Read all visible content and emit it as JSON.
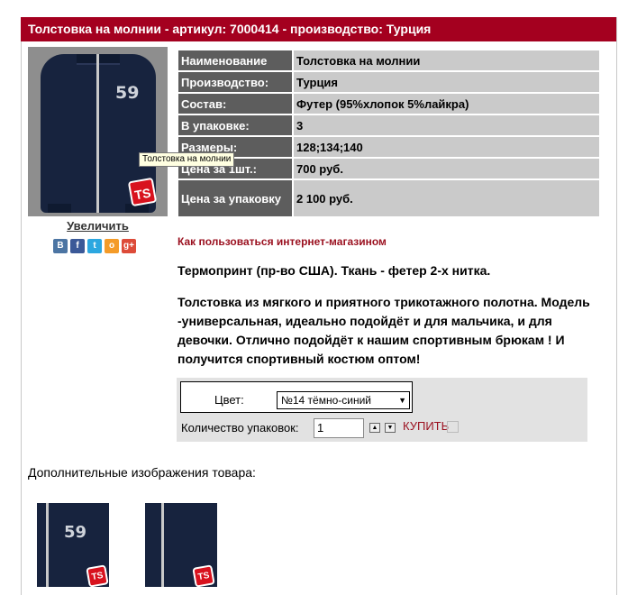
{
  "title": "Толстовка на молнии - артикул: 7000414 - производство: Турция",
  "image": {
    "number_print": "59",
    "logo_text": "TS",
    "tooltip": "Толстовка на молнии",
    "enlarge_label": "Увеличить"
  },
  "social": [
    {
      "icon": "vk-icon",
      "glyph": "В",
      "color": "#4c75a3"
    },
    {
      "icon": "facebook-icon",
      "glyph": "f",
      "color": "#3b5998"
    },
    {
      "icon": "twitter-icon",
      "glyph": "t",
      "color": "#2ca7e0"
    },
    {
      "icon": "odnoklassniki-icon",
      "glyph": "o",
      "color": "#f49b28"
    },
    {
      "icon": "googleplus-icon",
      "glyph": "g+",
      "color": "#dd4b39"
    }
  ],
  "specs": [
    {
      "key": "Наименование",
      "value": "Толстовка на молнии"
    },
    {
      "key": "Производство:",
      "value": "Турция"
    },
    {
      "key": "Состав:",
      "value": "Футер (95%хлопок 5%лайкра)"
    },
    {
      "key": "В упаковке:",
      "value": "3"
    },
    {
      "key": "Размеры:",
      "value": "128;134;140"
    },
    {
      "key": "Цена за 1шт.:",
      "value": "700 руб."
    },
    {
      "key": "Цена за упаковку",
      "value": "2 100 руб."
    }
  ],
  "how_to_link": "Как пользоваться интернет-магазином",
  "description_1": "Термопринт (пр-во США). Ткань - фетер 2-х нитка.",
  "description_2": "Толстовка из  мягкого и приятного трикотажного полотна. Модель -универсальная, идеально подойдёт и для мальчика, и для девочки. Отлично подойдёт к нашим спортивным брюкам ! И получится спортивный костюм оптом!",
  "order": {
    "color_label": "Цвет:",
    "color_value": "№14 тёмно-синий",
    "qty_label": "Количество упаковок:",
    "qty_value": "1",
    "buy_label": "КУПИТЬ"
  },
  "more_images_label": "Дополнительные изображения товара:",
  "colors": {
    "title_bg": "#a4001f",
    "key_bg": "#5d5d5d",
    "value_bg": "#cacaca",
    "link": "#9a0f1e",
    "jacket": "#17233e",
    "logo": "#d8121e"
  }
}
